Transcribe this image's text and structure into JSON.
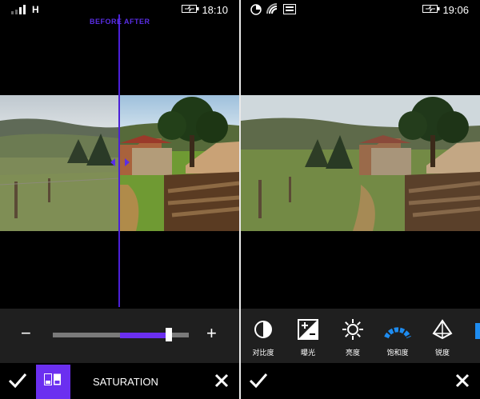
{
  "left_phone": {
    "status": {
      "network": "H",
      "time": "18:10"
    },
    "compare": {
      "before_label": "BEFORE",
      "after_label": "AFTER"
    },
    "slider": {
      "value": 0.86,
      "minus_label": "−",
      "plus_label": "+"
    },
    "bottom": {
      "accept_icon": "checkmark-icon",
      "compare_icon": "before-after-icon",
      "title": "SATURATION",
      "cancel_icon": "close-icon"
    },
    "colors": {
      "accent": "#6b2ff0",
      "compare_line": "#4b1fd8",
      "track": "#7a7a7a"
    }
  },
  "right_phone": {
    "status": {
      "time": "19:06"
    },
    "tools": [
      {
        "icon": "contrast-icon",
        "label": "对比度"
      },
      {
        "icon": "exposure-icon",
        "label": "曝光"
      },
      {
        "icon": "brightness-icon",
        "label": "亮度"
      },
      {
        "icon": "saturation-icon",
        "label": "饱和度"
      },
      {
        "icon": "sharpness-icon",
        "label": "锐度"
      }
    ],
    "bottom": {
      "accept_icon": "checkmark-icon",
      "cancel_icon": "close-icon"
    }
  }
}
